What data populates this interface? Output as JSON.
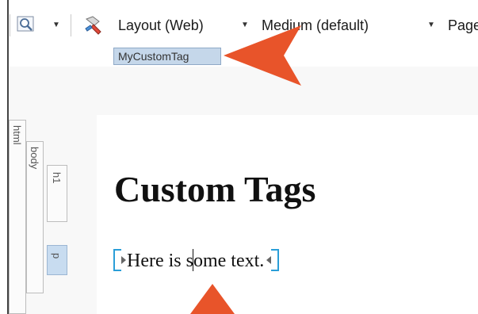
{
  "toolbar": {
    "zoom_icon": "magnifier-icon",
    "style_icon": "paint-brush-icon",
    "layout_label": "Layout (Web)",
    "size_label": "Medium (default)",
    "page_label": "Page"
  },
  "tag_marker": {
    "label": "MyCustomTag"
  },
  "structure_bars": [
    {
      "label": "html"
    },
    {
      "label": "body"
    },
    {
      "label": "h1"
    },
    {
      "label": "p"
    }
  ],
  "document": {
    "heading": "Custom Tags",
    "para_before_cursor": "Here is s",
    "para_after_cursor": "ome text."
  },
  "colors": {
    "accent_arrow": "#e8542a",
    "tag_highlight": "#c5d7ea",
    "bracket_blue": "#2a9ed8"
  }
}
